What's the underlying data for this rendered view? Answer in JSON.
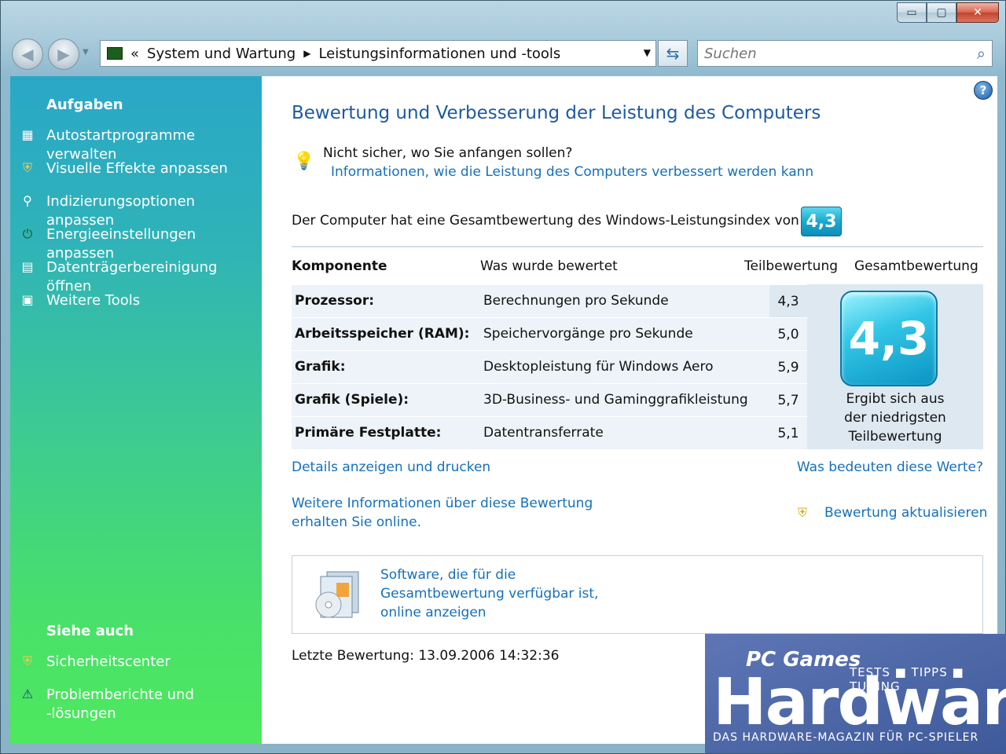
{
  "window": {
    "caption": {
      "minimize": "▭",
      "maximize": "▢",
      "close": "✕"
    }
  },
  "navbar": {
    "address_prefix": "«",
    "breadcrumb": [
      "System und Wartung",
      "Leistungsinformationen und -tools"
    ],
    "search_placeholder": "Suchen"
  },
  "sidebar": {
    "tasks_heading": "Aufgaben",
    "tasks": [
      {
        "label": "Autostartprogramme verwalten",
        "icon": "startup-programs-icon"
      },
      {
        "label": "Visuelle Effekte anpassen",
        "icon": "shield-icon"
      },
      {
        "label": "Indizierungsoptionen anpassen",
        "icon": "indexing-icon"
      },
      {
        "label": "Energieeinstellungen anpassen",
        "icon": "power-plug-icon"
      },
      {
        "label": "Datenträgerbereinigung öffnen",
        "icon": "disk-cleanup-icon"
      },
      {
        "label": "Weitere Tools",
        "icon": "tools-icon"
      }
    ],
    "see_also_heading": "Siehe auch",
    "see_also": [
      {
        "label": "Sicherheitscenter",
        "icon": "security-center-icon"
      },
      {
        "label": "Problemberichte und -lösungen",
        "line1": "Problemberichte und",
        "line2": "-lösungen",
        "icon": "problem-reports-icon"
      }
    ]
  },
  "main": {
    "title": "Bewertung und Verbesserung der Leistung des Computers",
    "tip_question": "Nicht sicher, wo Sie anfangen sollen?",
    "tip_link": "Informationen, wie die Leistung des Computers verbessert werden kann",
    "score_text": "Der Computer hat eine Gesamtbewertung des Windows-Leistungsindex von",
    "overall_score": "4,3",
    "table": {
      "headers": [
        "Komponente",
        "Was wurde bewertet",
        "Teilbewertung",
        "Gesamtbewertung"
      ],
      "rows": [
        {
          "component": "Prozessor:",
          "measured": "Berechnungen pro Sekunde",
          "subscore": "4,3"
        },
        {
          "component": "Arbeitsspeicher (RAM):",
          "measured": "Speichervorgänge pro Sekunde",
          "subscore": "5,0"
        },
        {
          "component": "Grafik:",
          "measured": "Desktopleistung für Windows Aero",
          "subscore": "5,9"
        },
        {
          "component": "Grafik (Spiele):",
          "measured": "3D-Business- und Gaminggrafikleistung",
          "subscore": "5,7"
        },
        {
          "component": "Primäre Festplatte:",
          "measured": "Datentransferrate",
          "subscore": "5,1"
        }
      ],
      "base_score_caption": [
        "Ergibt sich aus",
        "der niedrigsten",
        "Teilbewertung"
      ]
    },
    "links": {
      "details": "Details anzeigen und drucken",
      "meaning": "Was bedeuten diese Werte?",
      "more_info_line1": "Weitere Informationen über diese Bewertung",
      "more_info_line2": "erhalten Sie online.",
      "update": "Bewertung aktualisieren"
    },
    "software": {
      "line1": "Software, die für die",
      "line2": "Gesamtbewertung verfügbar ist,",
      "line3": "online anzeigen"
    },
    "last_rating": "Letzte Bewertung: 13.09.2006 14:32:36"
  },
  "watermark": {
    "brand": "PC Games",
    "tags": "TESTS ■ TIPPS ■ TUNING",
    "title": "Hardware",
    "subtitle": "DAS HARDWARE-MAGAZIN FÜR PC-SPIELER"
  },
  "colors": {
    "link": "#1670b8",
    "title": "#1e5aa0",
    "score_badge": "#19a9cf"
  }
}
